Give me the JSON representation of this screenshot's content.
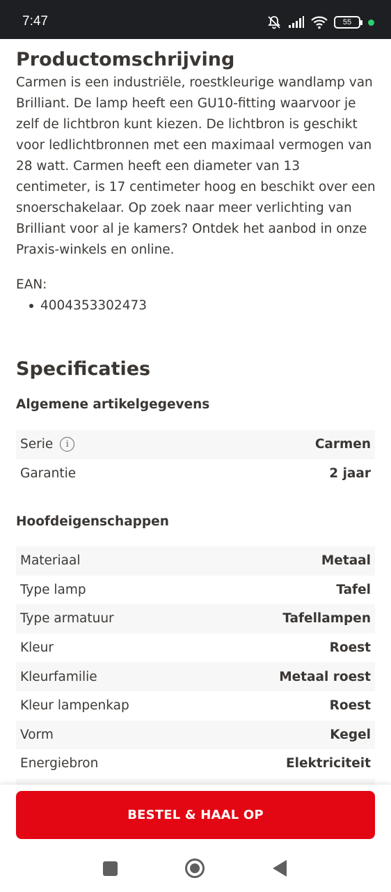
{
  "status_bar": {
    "time": "7:47",
    "battery": "55",
    "icons": [
      "bell-muted-icon",
      "signal-icon",
      "wifi-icon",
      "battery-icon",
      "dot-indicator-icon"
    ]
  },
  "description": {
    "title": "Productomschrijving",
    "body": "Carmen is een industriële, roestkleurige wandlamp van Brilliant. De lamp heeft een GU10-fitting waarvoor je zelf de lichtbron kunt kiezen. De lichtbron is geschikt voor ledlichtbronnen met een maximaal vermogen van 28 watt. Carmen heeft een diameter van 13 centimeter, is 17 centimeter hoog en beschikt over een snoerschakelaar. Op zoek naar meer verlichting van Brilliant voor al je kamers? Ontdek het aanbod in onze Praxis-winkels en online.",
    "ean_label": "EAN:",
    "ean_values": [
      "4004353302473"
    ]
  },
  "specs": {
    "title": "Specificaties",
    "groups": [
      {
        "title": "Algemene artikelgegevens",
        "rows": [
          {
            "key": "Serie",
            "value": "Carmen",
            "info": true
          },
          {
            "key": "Garantie",
            "value": "2 jaar"
          }
        ]
      },
      {
        "title": "Hoofdeigenschappen",
        "rows": [
          {
            "key": "Materiaal",
            "value": "Metaal"
          },
          {
            "key": "Type lamp",
            "value": "Tafel"
          },
          {
            "key": "Type armatuur",
            "value": "Tafellampen"
          },
          {
            "key": "Kleur",
            "value": "Roest"
          },
          {
            "key": "Kleurfamilie",
            "value": "Metaal roest"
          },
          {
            "key": "Kleur lampenkap",
            "value": "Roest"
          },
          {
            "key": "Vorm",
            "value": "Kegel"
          },
          {
            "key": "Energiebron",
            "value": "Elektriciteit"
          }
        ]
      }
    ]
  },
  "cta": {
    "label": "BESTEL & HAAL OP"
  },
  "colors": {
    "accent": "#e30613",
    "text": "#3a3633",
    "row_shade": "#f7f7f7",
    "status_bar": "#1d1f22"
  }
}
